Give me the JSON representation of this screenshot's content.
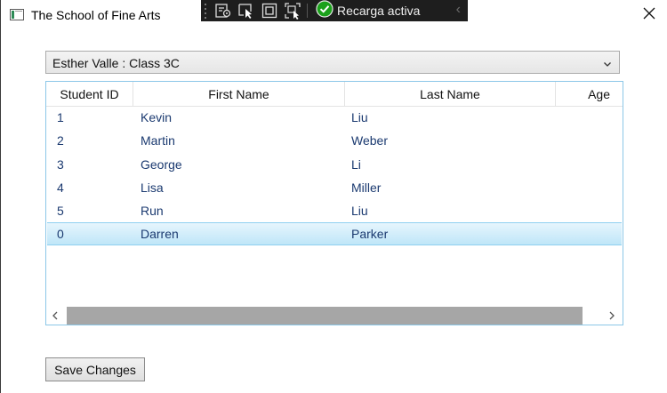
{
  "window": {
    "title": "The School of Fine Arts",
    "close_icon": "close-icon"
  },
  "debug_toolbar": {
    "icons": [
      "live-visual-tree-icon",
      "select-element-icon",
      "display-layout-adorners-icon",
      "track-focused-element-icon"
    ],
    "hot_reload_label": "Recarga activa",
    "collapse_icon": "chevron-left-icon",
    "accent": "#1ba11b"
  },
  "teacher_select": {
    "selected": "Esther Valle : Class 3C"
  },
  "grid": {
    "columns": [
      "Student ID",
      "First Name",
      "Last Name",
      "Age"
    ],
    "rows": [
      {
        "id": "1",
        "first": "Kevin",
        "last": "Liu"
      },
      {
        "id": "2",
        "first": "Martin",
        "last": "Weber"
      },
      {
        "id": "3",
        "first": "George",
        "last": "Li"
      },
      {
        "id": "4",
        "first": "Lisa",
        "last": "Miller"
      },
      {
        "id": "5",
        "first": "Run",
        "last": "Liu"
      },
      {
        "id": "0",
        "first": "Darren",
        "last": "Parker"
      }
    ],
    "selected_row": 5,
    "selection_color": "#bfe6f8"
  },
  "save_button": {
    "label": "Save Changes"
  }
}
